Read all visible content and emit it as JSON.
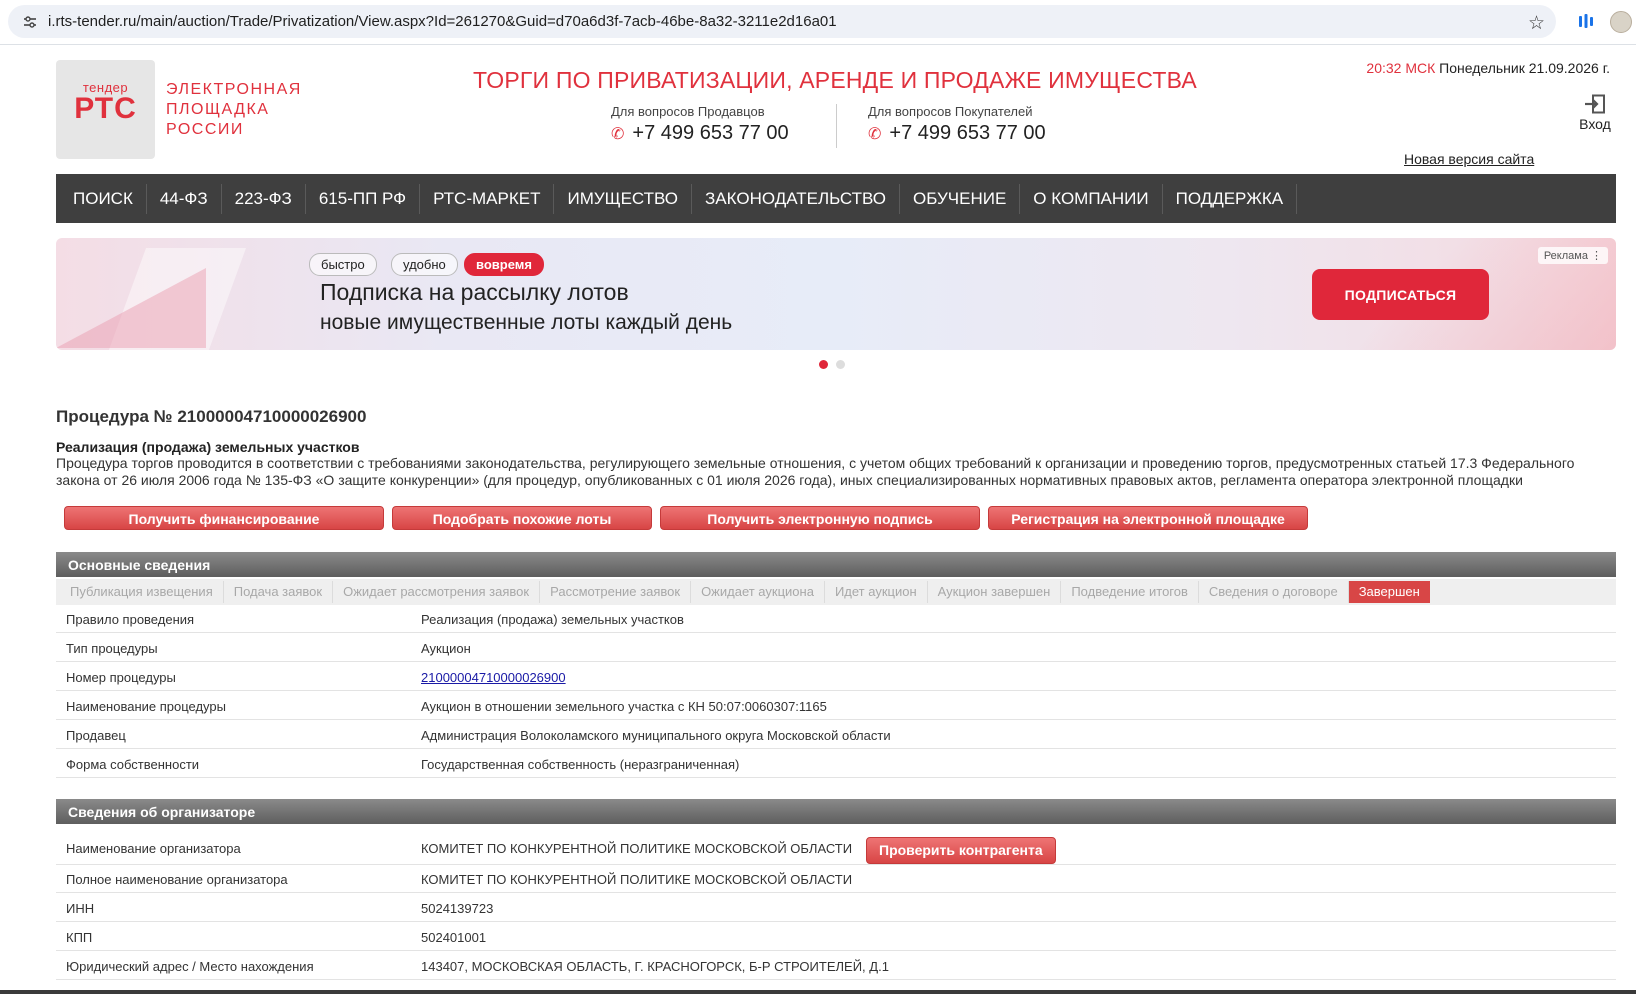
{
  "browser": {
    "url": "i.rts-tender.ru/main/auction/Trade/Privatization/View.aspx?Id=261270&Guid=d70a6d3f-7acb-46be-8a32-3211e2d16a01"
  },
  "header": {
    "logo_small": "тендер",
    "logo_big": "РТС",
    "logo_text": "ЭЛЕКТРОННАЯ ПЛОЩАДКА РОССИИ",
    "title": "ТОРГИ ПО ПРИВАТИЗАЦИИ, АРЕНДЕ И ПРОДАЖЕ ИМУЩЕСТВА",
    "sellers_label": "Для вопросов Продавцов",
    "sellers_phone": "+7 499 653 77 00",
    "buyers_label": "Для вопросов Покупателей",
    "buyers_phone": "+7 499 653 77 00",
    "time": "20:32 МСК",
    "date": "Понедельник 21.09.2026 г.",
    "login": "Вход",
    "new_version": "Новая версия сайта"
  },
  "nav": [
    "ПОИСК",
    "44-ФЗ",
    "223-ФЗ",
    "615-ПП РФ",
    "РТС-МАРКЕТ",
    "ИМУЩЕСТВО",
    "ЗАКОНОДАТЕЛЬСТВО",
    "ОБУЧЕНИЕ",
    "О КОМПАНИИ",
    "ПОДДЕРЖКА"
  ],
  "banner": {
    "chip1": "быстро",
    "chip2": "удобно",
    "chip3": "вовремя",
    "title": "Подписка на рассылку лотов",
    "subtitle": "новые имущественные лоты каждый день",
    "button": "ПОДПИСАТЬСЯ",
    "ad": "Реклама ⋮",
    "active_slide": 1,
    "slides": 2
  },
  "procedure": {
    "title": "Процедура № 21000004710000026900",
    "kind": "Реализация (продажа) земельных участков",
    "description": "Процедура торгов проводится в соответствии с требованиями законодательства, регулирующего земельные отношения, с учетом общих требований к организации и проведению торгов, предусмотренных статьей 17.3 Федерального закона от 26 июля 2006 года № 135-ФЗ «О защите конкуренции» (для процедур, опубликованных с 01 июля 2026 года), иных специализированных нормативных правовых актов, регламента оператора электронной площадки"
  },
  "actions": [
    "Получить финансирование",
    "Подобрать похожие лоты",
    "Получить электронную подпись",
    "Регистрация на электронной площадке"
  ],
  "main_section": {
    "title": "Основные сведения",
    "steps": [
      "Публикация извещения",
      "Подача заявок",
      "Ожидает рассмотрения заявок",
      "Рассмотрение заявок",
      "Ожидает аукциона",
      "Идет аукцион",
      "Аукцион завершен",
      "Подведение итогов",
      "Сведения о договоре",
      "Завершен"
    ],
    "rows": [
      {
        "k": "Правило проведения",
        "v": "Реализация (продажа) земельных участков"
      },
      {
        "k": "Тип процедуры",
        "v": "Аукцион"
      },
      {
        "k": "Номер процедуры",
        "v": "21000004710000026900"
      },
      {
        "k": "Наименование процедуры",
        "v": "Аукцион в отношении земельного участка с КН 50:07:0060307:1165"
      },
      {
        "k": "Продавец",
        "v": "Администрация Волоколамского муниципального округа Московской области"
      },
      {
        "k": "Форма собственности",
        "v": "Государственная собственность (неразграниченная)"
      }
    ]
  },
  "organizer_section": {
    "title": "Сведения об организаторе",
    "check_button": "Проверить контрагента",
    "rows": [
      {
        "k": "Наименование организатора",
        "v": "КОМИТЕТ ПО КОНКУРЕНТНОЙ ПОЛИТИКЕ МОСКОВСКОЙ ОБЛАСТИ"
      },
      {
        "k": "Полное наименование организатора",
        "v": "КОМИТЕТ ПО КОНКУРЕНТНОЙ ПОЛИТИКЕ МОСКОВСКОЙ ОБЛАСТИ"
      },
      {
        "k": "ИНН",
        "v": "5024139723"
      },
      {
        "k": "КПП",
        "v": "502401001"
      },
      {
        "k": "Юридический адрес / Место нахождения",
        "v": "143407, МОСКОВСКАЯ ОБЛАСТЬ, Г. КРАСНОГОРСК, Б-Р СТРОИТЕЛЕЙ, Д.1"
      }
    ]
  },
  "colors": {
    "brand_red": "#e0313d",
    "nav_bg": "#3f3f3f",
    "button_red": "#d84545"
  },
  "icons": [
    "tune-icon",
    "star-icon",
    "extension-icon",
    "profile-icon",
    "phone-icon",
    "login-icon"
  ]
}
